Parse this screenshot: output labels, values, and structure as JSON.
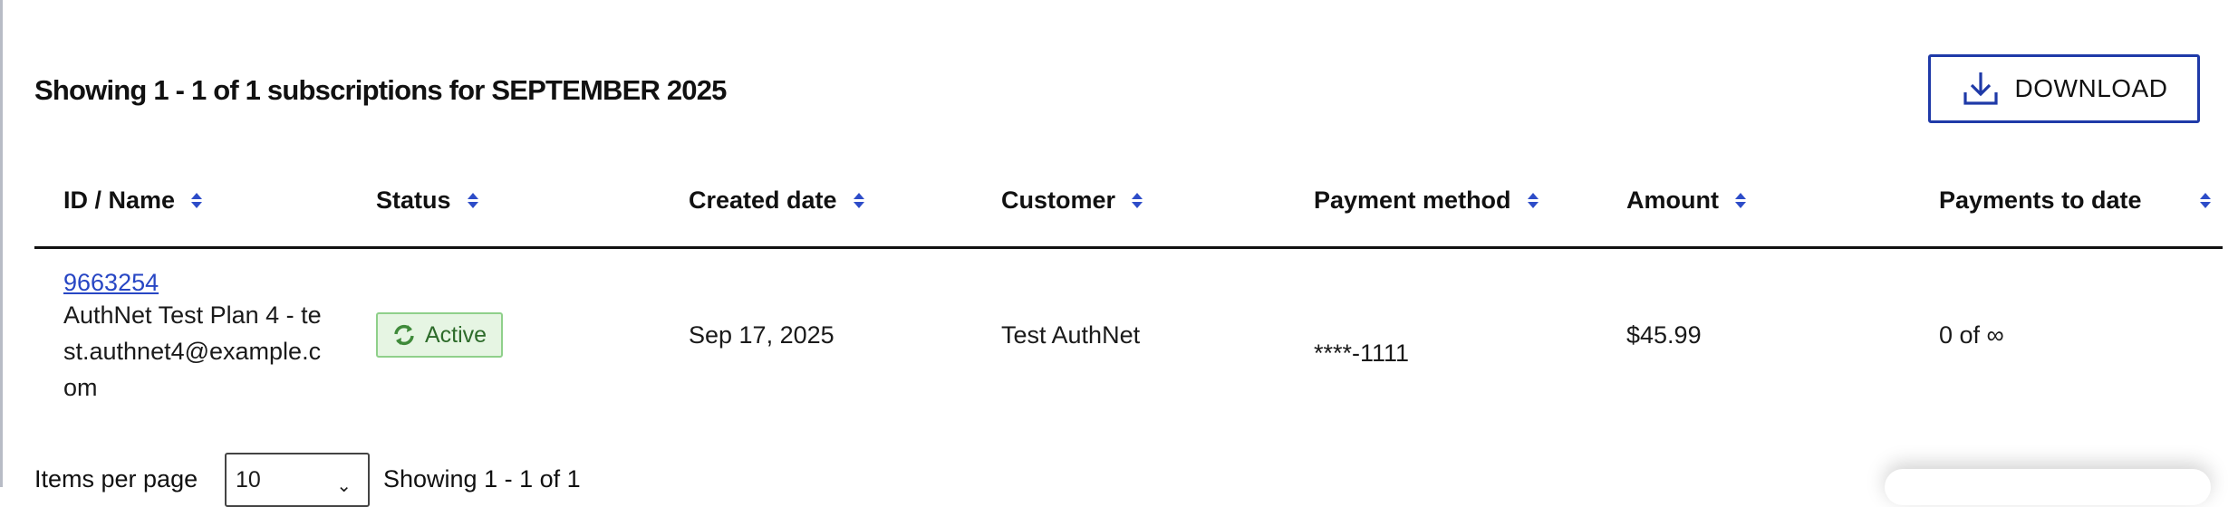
{
  "summary": "Showing 1 - 1 of 1 subscriptions for SEPTEMBER 2025",
  "download_label": "DOWNLOAD",
  "columns": [
    "ID / Name",
    "Status",
    "Created date",
    "Customer",
    "Payment method",
    "Amount",
    "Payments to date"
  ],
  "rows": [
    {
      "id": "9663254",
      "name": "AuthNet Test Plan 4 - test.authnet4@example.com",
      "status": "Active",
      "created": "Sep 17, 2025",
      "customer": "Test AuthNet",
      "payment_method": "****-1111",
      "amount": "$45.99",
      "payments_to_date": "0 of ∞"
    }
  ],
  "footer": {
    "items_per_page_label": "Items per page",
    "items_per_page_value": "10",
    "showing": "Showing 1 - 1 of 1"
  },
  "colors": {
    "accent": "#1f3aa8",
    "link": "#2746c4",
    "status_bg": "#e6f5e3",
    "status_border": "#8fd08a"
  },
  "icons": {
    "download": "download-icon",
    "status": "refresh-icon",
    "sort": "sort-icon"
  }
}
